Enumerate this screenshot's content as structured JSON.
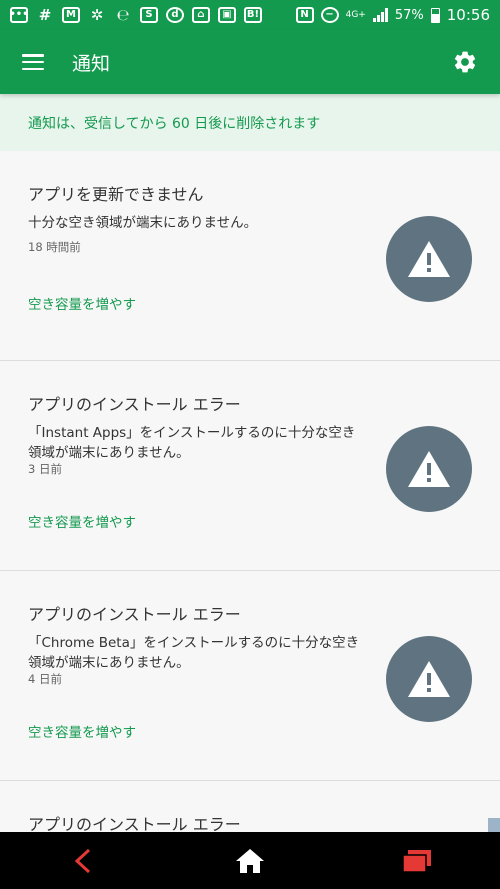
{
  "status_bar": {
    "network": "4G+",
    "battery": "57%",
    "time": "10:56",
    "icons": [
      "chat-icon",
      "slack-icon",
      "gmail-icon",
      "pinwheel-icon",
      "e-icon",
      "s-icon",
      "d-icon",
      "home-app-icon",
      "app-icon",
      "hatena-icon",
      "nfc-icon",
      "do-not-disturb-icon"
    ]
  },
  "app_bar": {
    "title": "通知",
    "menu_icon": "hamburger-menu-icon",
    "settings_icon": "gear-icon"
  },
  "banner": {
    "text": "通知は、受信してから 60 日後に削除されます"
  },
  "notifications": [
    {
      "title": "アプリを更新できません",
      "body": "十分な空き領域が端末にありません。",
      "time": "18 時間前",
      "action": "空き容量を増やす",
      "icon": "warning-icon"
    },
    {
      "title": "アプリのインストール エラー",
      "body": "「Instant Apps」をインストールするのに十分な空き領域が端末にありません。",
      "time": "3 日前",
      "action": "空き容量を増やす",
      "icon": "warning-icon"
    },
    {
      "title": "アプリのインストール エラー",
      "body": "「Chrome Beta」をインストールするのに十分な空き領域が端末にありません。",
      "time": "4 日前",
      "action": "空き容量を増やす",
      "icon": "warning-icon"
    },
    {
      "title": "アプリのインストール エラー"
    }
  ],
  "nav_bar": {
    "back_icon": "back-icon",
    "home_icon": "home-icon",
    "recents_icon": "recents-icon"
  },
  "colors": {
    "brand_green": "#149a4f",
    "banner_bg": "#e8f5ec",
    "warning_circle": "#5f7480",
    "nav_accent": "#e53935"
  }
}
